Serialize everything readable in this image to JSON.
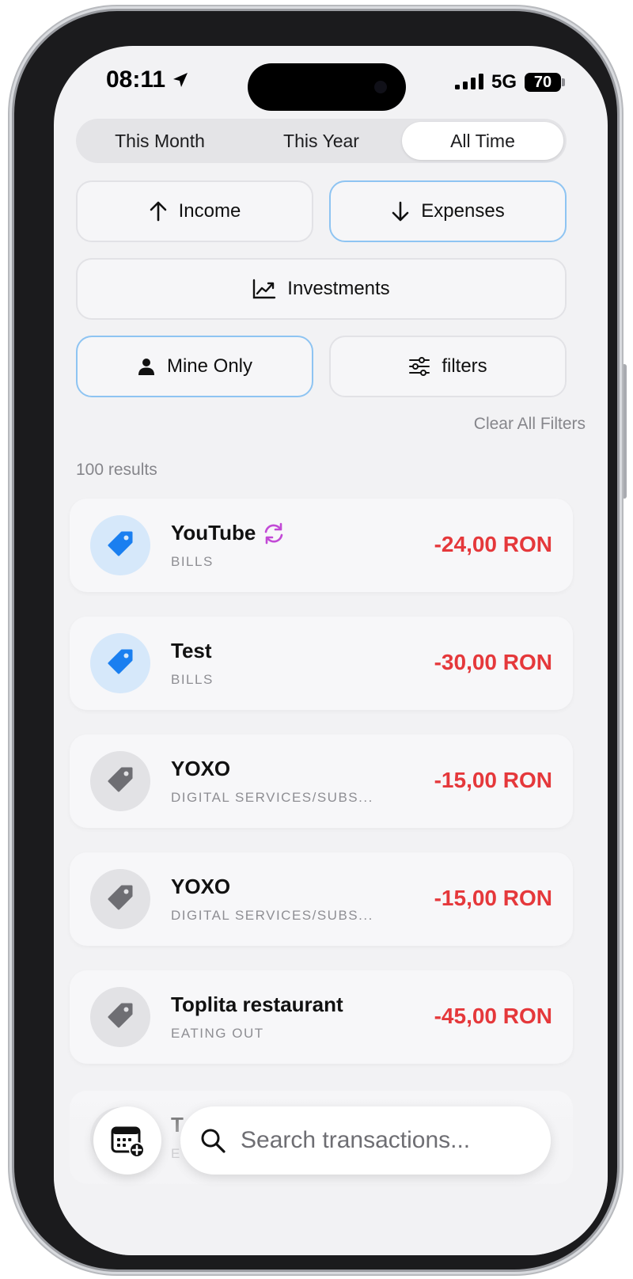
{
  "status_bar": {
    "time": "08:11",
    "network": "5G",
    "battery": "70"
  },
  "period_tabs": [
    {
      "label": "This Month",
      "active": false
    },
    {
      "label": "This Year",
      "active": false
    },
    {
      "label": "All Time",
      "active": true
    }
  ],
  "type_filters": {
    "income": {
      "label": "Income",
      "selected": false
    },
    "expenses": {
      "label": "Expenses",
      "selected": true
    },
    "investments": {
      "label": "Investments",
      "selected": false
    }
  },
  "owner_filter": {
    "label": "Mine Only",
    "selected": true
  },
  "filters_button": {
    "label": "filters"
  },
  "clear_filters": "Clear All Filters",
  "results_count": "100 results",
  "transactions": [
    {
      "title": "YouTube",
      "category": "BILLS",
      "amount": "-24,00 RON",
      "recurring": true,
      "icon": "tag-icon",
      "style": "blue"
    },
    {
      "title": "Test",
      "category": "BILLS",
      "amount": "-30,00 RON",
      "recurring": false,
      "icon": "tag-icon",
      "style": "blue"
    },
    {
      "title": "YOXO",
      "category": "DIGITAL SERVICES/SUBS...",
      "amount": "-15,00 RON",
      "recurring": false,
      "icon": "tag-icon",
      "style": "gray"
    },
    {
      "title": "YOXO",
      "category": "DIGITAL SERVICES/SUBS...",
      "amount": "-15,00 RON",
      "recurring": false,
      "icon": "tag-icon",
      "style": "gray"
    },
    {
      "title": "Toplita restaurant",
      "category": "EATING OUT",
      "amount": "-45,00 RON",
      "recurring": false,
      "icon": "tag-icon",
      "style": "gray"
    }
  ],
  "partial_transaction": {
    "title": "T",
    "category": "E"
  },
  "search": {
    "placeholder": "Search transactions..."
  },
  "colors": {
    "accent": "#1a7ff0",
    "accent_soft": "#d6e8fa",
    "negative": "#e5383b",
    "recurring": "#c24ad6",
    "selected_border": "#8ec4f2"
  }
}
